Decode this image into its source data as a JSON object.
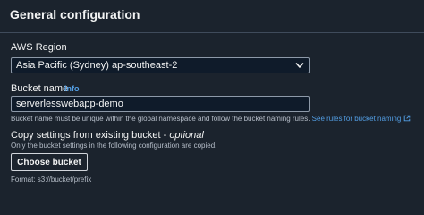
{
  "section": {
    "title": "General configuration"
  },
  "aws_region": {
    "label": "AWS Region",
    "selected": "Asia Pacific (Sydney) ap-southeast-2"
  },
  "bucket_name": {
    "label": "Bucket name",
    "info_link": "Info",
    "value": "serverlesswebapp-demo",
    "hint_text": "Bucket name must be unique within the global namespace and follow the bucket naming rules.",
    "hint_link": "See rules for bucket naming"
  },
  "copy_settings": {
    "label": "Copy settings from existing bucket",
    "separator": " - ",
    "optional": "optional",
    "description": "Only the bucket settings in the following configuration are copied.",
    "button_label": "Choose bucket",
    "format_text": "Format: s3://bucket/prefix"
  },
  "colors": {
    "background": "#1b232d",
    "link": "#539fe5",
    "border": "#8d99a8",
    "text": "#f2f3f3"
  },
  "icons": {
    "select_caret": "chevron-down-icon",
    "external_link": "external-link-icon"
  }
}
